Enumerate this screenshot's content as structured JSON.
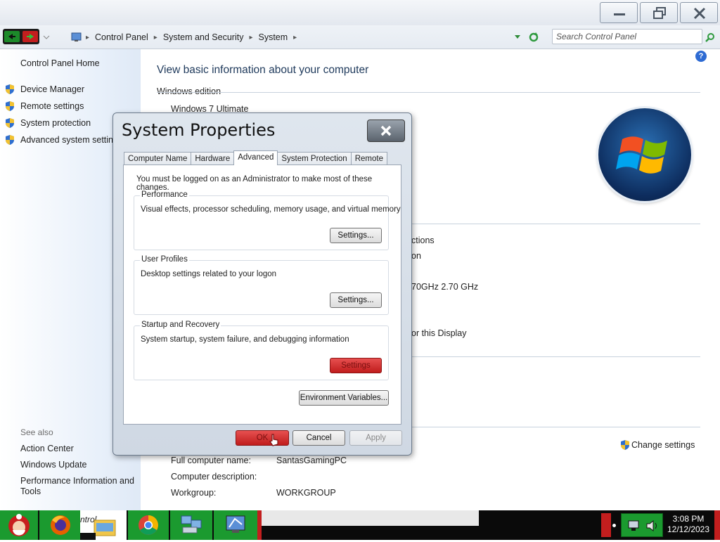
{
  "window": {
    "minimize_icon": "minimize-icon",
    "restore_icon": "restore-icon",
    "close_icon": "close-icon"
  },
  "address": {
    "crumbs": [
      "Control Panel",
      "System and Security",
      "System"
    ],
    "search_placeholder": "Search Control Panel"
  },
  "left_pane": {
    "home": "Control Panel Home",
    "items": [
      "Device Manager",
      "Remote settings",
      "System protection",
      "Advanced system settings"
    ],
    "see_also_heading": "See also",
    "see_also": [
      "Action Center",
      "Windows Update",
      "Performance Information and Tools"
    ]
  },
  "main": {
    "title": "View basic information about your computer",
    "windows_edition_heading": "Windows edition",
    "edition": "Windows 7 Ultimate",
    "partial_1": "ctions",
    "partial_2": "on",
    "partial_3": "70GHz  2.70 GHz",
    "partial_4": "or this Display",
    "change_settings": "Change settings",
    "full_name_label": "Full computer name:",
    "full_name_value": "SantasGamingPC",
    "description_label": "Computer description:",
    "workgroup_label": "Workgroup:",
    "workgroup_value": "WORKGROUP"
  },
  "dialog": {
    "title": "System Properties",
    "tabs": [
      "Computer Name",
      "Hardware",
      "Advanced",
      "System Protection",
      "Remote"
    ],
    "active_tab": "Advanced",
    "notice": "You must be logged on as an Administrator to make most of these changes.",
    "performance": {
      "label": "Performance",
      "description": "Visual effects, processor scheduling, memory usage, and virtual memory",
      "button": "Settings..."
    },
    "user_profiles": {
      "label": "User Profiles",
      "description": "Desktop settings related to your logon",
      "button": "Settings..."
    },
    "startup": {
      "label": "Startup and Recovery",
      "description": "System startup, system failure, and debugging information",
      "button": "Settings"
    },
    "env_button": "Environment Variables...",
    "ok": "OK",
    "cancel": "Cancel",
    "apply": "Apply"
  },
  "taskbar": {
    "partial_label": "ntrol",
    "time": "3:08 PM",
    "date": "12/12/2023"
  },
  "colors": {
    "accent_green": "#1b9a2f",
    "highlight_red": "#d32a2a",
    "title_blue": "#1e395b"
  }
}
